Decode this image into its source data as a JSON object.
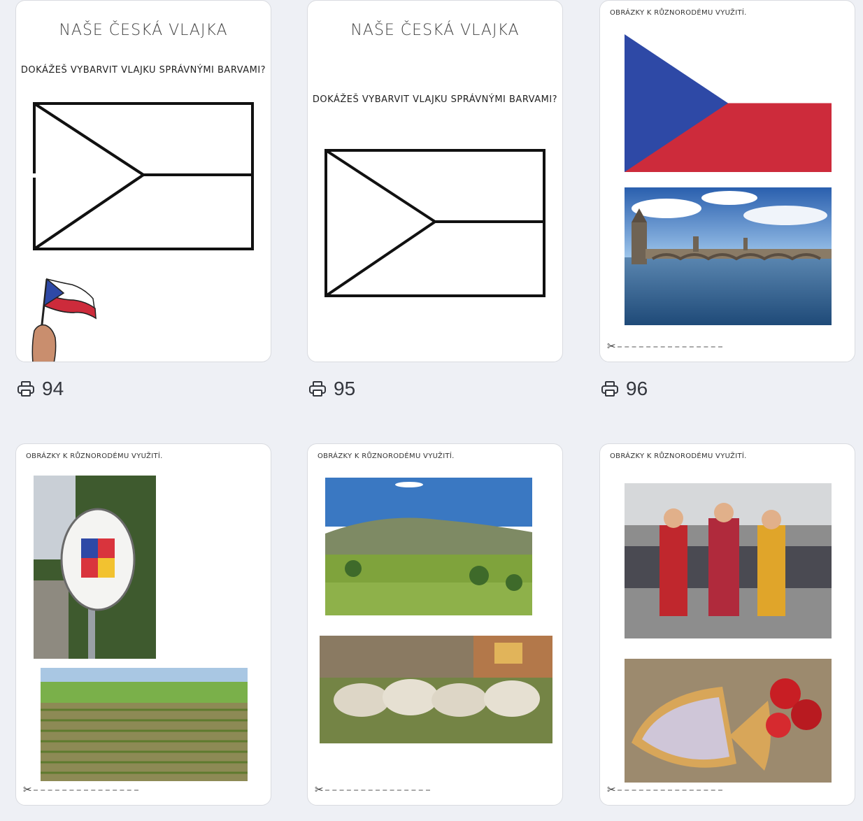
{
  "cards": [
    {
      "title": "NAŠE ČESKÁ VLAJKA",
      "subtitle": "DOKÁŽEŠ VYBARVIT VLAJKU SPRÁVNÝMI BARVAMI?",
      "prints": "94"
    },
    {
      "title": "NAŠE ČESKÁ VLAJKA",
      "subtitle": "DOKÁŽEŠ VYBARVIT VLAJKU SPRÁVNÝMI BARVAMI?",
      "prints": "95"
    },
    {
      "tag": "OBRÁZKY K RŮZNORODÉMU VYUŽITÍ.",
      "prints": "96"
    },
    {
      "tag": "OBRÁZKY K RŮZNORODÉMU VYUŽITÍ."
    },
    {
      "tag": "OBRÁZKY K RŮZNORODÉMU VYUŽITÍ."
    },
    {
      "tag": "OBRÁZKY K RŮZNORODÉMU VYUŽITÍ."
    }
  ],
  "scissors": "✂",
  "icons": {
    "print": "printer-icon",
    "cut": "scissors-icon"
  },
  "colors": {
    "flag_blue": "#2e49a6",
    "flag_red": "#cd2b3b",
    "page_bg": "#eef0f5"
  }
}
